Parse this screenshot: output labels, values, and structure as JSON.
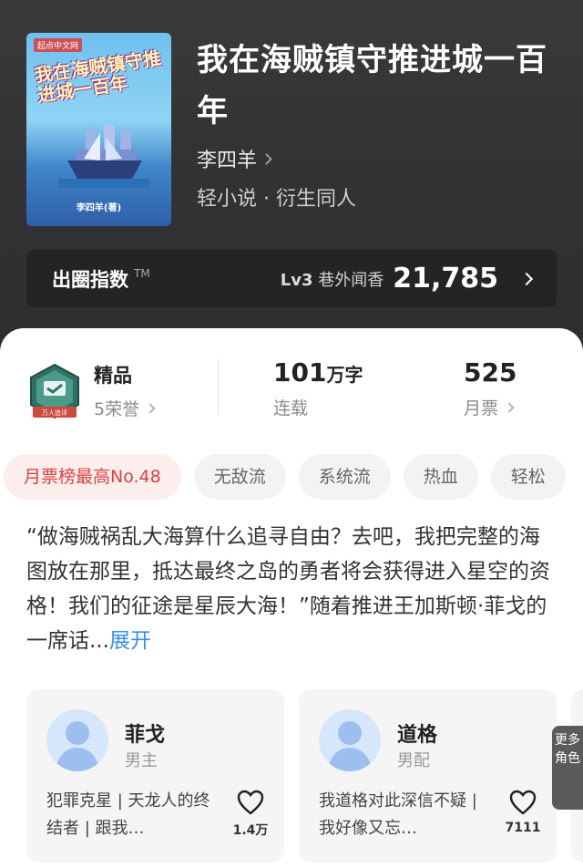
{
  "book": {
    "title": "我在海贼镇守推进城一百年",
    "author": "李四羊",
    "genre": "轻小说 · 衍生同人",
    "cover": {
      "publisher_logo": "起点中文网",
      "title_art": "我在海贼镇守推进城一百年",
      "author": "李四羊(著)"
    }
  },
  "influence": {
    "label": "出圈指数",
    "tm": "TM",
    "level": "Lv3",
    "level_name": "巷外闻香",
    "value": "21,785"
  },
  "stats": {
    "quality": "精品",
    "honors": "5荣誉",
    "badge_caption": "万人追评",
    "word_count_num": "101",
    "word_count_unit": "万字",
    "status": "连载",
    "monthly_tickets": "525",
    "monthly_label": "月票"
  },
  "tags": [
    "月票榜最高No.48",
    "无敌流",
    "系统流",
    "热血",
    "轻松"
  ],
  "synopsis": {
    "text": "“做海贼祸乱大海算什么追寻自由？去吧，我把完整的海图放在那里，抵达最终之岛的勇者将会获得进入星空的资格！我们的征途是星辰大海！”随着推进王加斯顿·菲戈的一席话...",
    "expand": "展开"
  },
  "characters": [
    {
      "name": "菲戈",
      "role": "男主",
      "desc": "犯罪克星 | 天龙人的终结者 | 跟我…",
      "likes": "1.4万"
    },
    {
      "name": "道格",
      "role": "男配",
      "desc": "我道格对此深信不疑 | 我好像又忘…",
      "likes": "7111"
    }
  ],
  "more_roles": "更多角色",
  "colors": {
    "accent_red": "#d8423f",
    "link_blue": "#3a8ee6",
    "header_bg": "#333335"
  }
}
